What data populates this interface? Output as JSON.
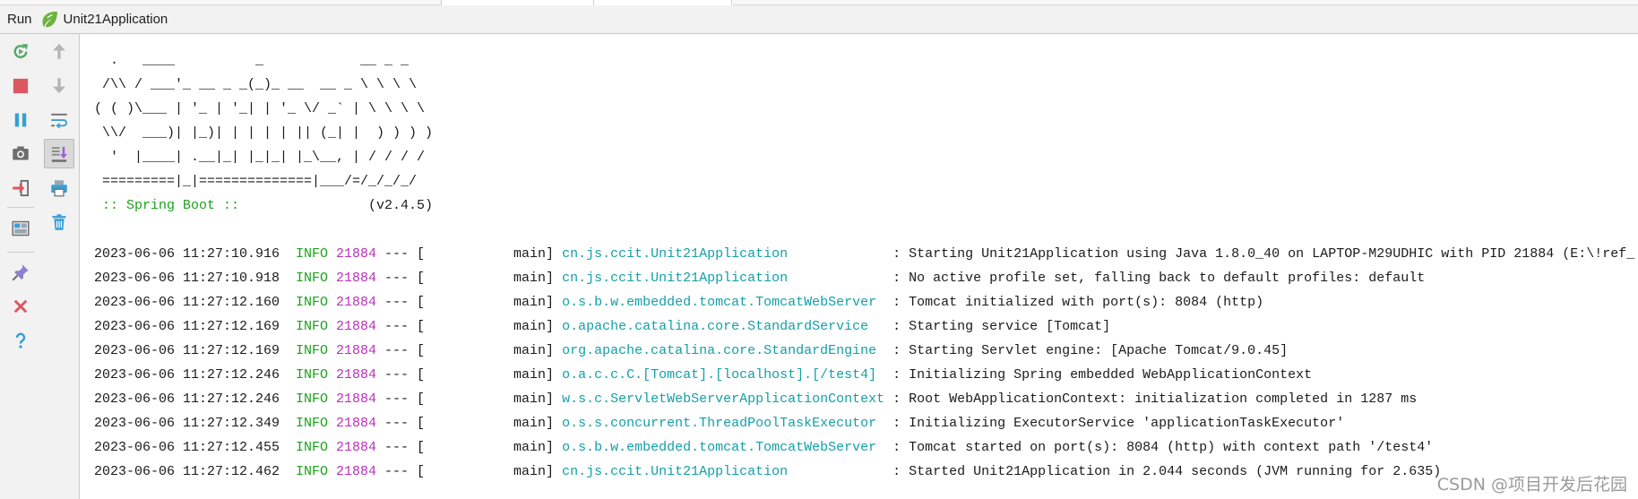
{
  "header": {
    "tool_window_label": "Run",
    "config_icon": "spring-boot-run-config-icon",
    "config_name": "Unit21Application"
  },
  "toolbar": {
    "left_column": [
      "rerun-icon",
      "stop-icon",
      "pause-icon",
      "dump-threads-icon",
      "exit-icon",
      "restore-layout-icon",
      "pin-tab-icon",
      "close-icon",
      "help-icon"
    ],
    "right_column": [
      "up-arrow-icon",
      "down-arrow-icon",
      "soft-wrap-icon",
      "scroll-to-end-icon",
      "print-icon",
      "clear-all-icon"
    ],
    "selected": "scroll-to-end-icon"
  },
  "console": {
    "banner_lines": [
      "  .   ____          _            __ _ _",
      " /\\\\ / ___'_ __ _ _(_)_ __  __ _ \\ \\ \\ \\",
      "( ( )\\___ | '_ | '_| | '_ \\/ _` | \\ \\ \\ \\",
      " \\\\/  ___)| |_)| | | | | || (_| |  ) ) ) )",
      "  '  |____| .__|_| |_|_| |_\\__, | / / / /",
      " =========|_|==============|___/=/_/_/_/"
    ],
    "spring_boot_label": ":: Spring Boot ::",
    "spring_boot_version": "(v2.4.5)",
    "log_lines": [
      {
        "timestamp": "2023-06-06 11:27:10.916",
        "level": "INFO",
        "pid": "21884",
        "thread": "--- [           main]",
        "logger": "cn.js.ccit.Unit21Application",
        "message": ": Starting Unit21Application using Java 1.8.0_40 on LAPTOP-M29UDHIC with PID 21884 (E:\\!ref_"
      },
      {
        "timestamp": "2023-06-06 11:27:10.918",
        "level": "INFO",
        "pid": "21884",
        "thread": "--- [           main]",
        "logger": "cn.js.ccit.Unit21Application",
        "message": ": No active profile set, falling back to default profiles: default"
      },
      {
        "timestamp": "2023-06-06 11:27:12.160",
        "level": "INFO",
        "pid": "21884",
        "thread": "--- [           main]",
        "logger": "o.s.b.w.embedded.tomcat.TomcatWebServer",
        "message": ": Tomcat initialized with port(s): 8084 (http)"
      },
      {
        "timestamp": "2023-06-06 11:27:12.169",
        "level": "INFO",
        "pid": "21884",
        "thread": "--- [           main]",
        "logger": "o.apache.catalina.core.StandardService",
        "message": ": Starting service [Tomcat]"
      },
      {
        "timestamp": "2023-06-06 11:27:12.169",
        "level": "INFO",
        "pid": "21884",
        "thread": "--- [           main]",
        "logger": "org.apache.catalina.core.StandardEngine",
        "message": ": Starting Servlet engine: [Apache Tomcat/9.0.45]"
      },
      {
        "timestamp": "2023-06-06 11:27:12.246",
        "level": "INFO",
        "pid": "21884",
        "thread": "--- [           main]",
        "logger": "o.a.c.c.C.[Tomcat].[localhost].[/test4]",
        "message": ": Initializing Spring embedded WebApplicationContext"
      },
      {
        "timestamp": "2023-06-06 11:27:12.246",
        "level": "INFO",
        "pid": "21884",
        "thread": "--- [           main]",
        "logger": "w.s.c.ServletWebServerApplicationContext",
        "message": ": Root WebApplicationContext: initialization completed in 1287 ms"
      },
      {
        "timestamp": "2023-06-06 11:27:12.349",
        "level": "INFO",
        "pid": "21884",
        "thread": "--- [           main]",
        "logger": "o.s.s.concurrent.ThreadPoolTaskExecutor",
        "message": ": Initializing ExecutorService 'applicationTaskExecutor'"
      },
      {
        "timestamp": "2023-06-06 11:27:12.455",
        "level": "INFO",
        "pid": "21884",
        "thread": "--- [           main]",
        "logger": "o.s.b.w.embedded.tomcat.TomcatWebServer",
        "message": ": Tomcat started on port(s): 8084 (http) with context path '/test4'"
      },
      {
        "timestamp": "2023-06-06 11:27:12.462",
        "level": "INFO",
        "pid": "21884",
        "thread": "--- [           main]",
        "logger": "cn.js.ccit.Unit21Application",
        "message": ": Started Unit21Application in 2.044 seconds (JVM running for 2.635)"
      }
    ]
  },
  "watermark": "CSDN @项目开发后花园",
  "colors": {
    "text": "#1b1b1b",
    "info": "#1ca21c",
    "pid": "#bb2fbb",
    "logger": "#139fa8",
    "spring": "#1ca21c",
    "version": "#1b1b1b",
    "watermark": "#9b9b9b"
  }
}
